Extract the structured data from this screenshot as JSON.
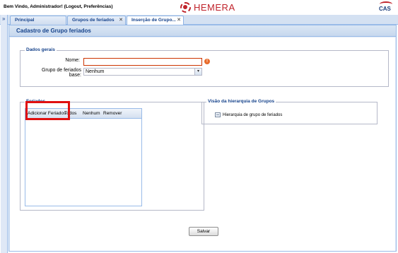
{
  "header": {
    "welcome": "Bem Vindo, Administrador! (Logout, Preferências)",
    "logo_text": "HEMERA",
    "cas_text": "CAS"
  },
  "tabs": [
    {
      "label": "Principal"
    },
    {
      "label": "Grupos de feriados"
    },
    {
      "label": "Inserção de Grupo..."
    }
  ],
  "panel": {
    "title": "Cadastro de Grupo feriados"
  },
  "dados_gerais": {
    "legend": "Dados gerais",
    "nome_label": "Nome:",
    "nome_value": "",
    "grupo_label_line1": "Grupo de feriados",
    "grupo_label_line2": "base:",
    "grupo_value": "Nenhum"
  },
  "feriados": {
    "legend": "Feriados",
    "toolbar": {
      "adicionar": "Adicionar Feriados",
      "todos": "Todos",
      "nenhum": "Nenhum",
      "remover": "Remover"
    }
  },
  "hierarquia": {
    "legend": "Visão da hierarquia de Grupos",
    "root": "Hierarquia de grupo de feriados"
  },
  "actions": {
    "salvar": "Salvar"
  },
  "colors": {
    "brand_red": "#c0232b",
    "panel_blue": "#15428b",
    "highlight": "#e01010"
  }
}
